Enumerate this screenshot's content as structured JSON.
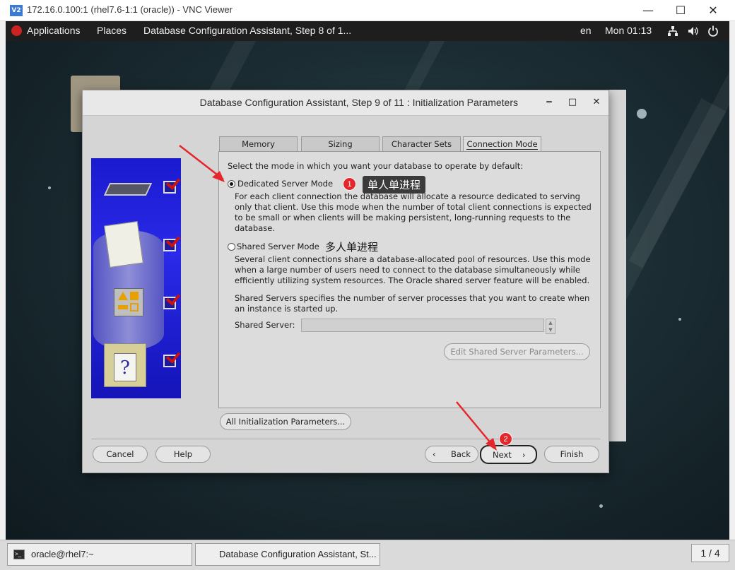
{
  "vnc": {
    "title": "172.16.0.100:1 (rhel7.6-1:1 (oracle)) - VNC Viewer",
    "logo": "V2",
    "minimize": "—",
    "maximize": "☐",
    "close": "✕"
  },
  "panel": {
    "applications": "Applications",
    "places": "Places",
    "window_title": "Database Configuration Assistant, Step 8 of 1...",
    "lang": "en",
    "clock": "Mon 01:13",
    "network_icon": "network-icon",
    "volume_icon": "volume-icon",
    "power_icon": "power-icon"
  },
  "dialog": {
    "title": "Database Configuration Assistant, Step 9 of 11 : Initialization Parameters",
    "min": "‒",
    "max": "□",
    "close": "✕",
    "tabs": [
      {
        "label": "Memory"
      },
      {
        "label": "Sizing"
      },
      {
        "label": "Character Sets"
      },
      {
        "label": "Connection Mode"
      }
    ],
    "active_tab": "Connection Mode",
    "intro": "Select the mode in which you want your database to operate by default:",
    "dedicated": {
      "label": "Dedicated Server Mode",
      "selected": true,
      "desc": [
        "For each client connection the database will allocate a resource dedicated to serving",
        "only that client.  Use this mode when the number of total client connections is expected",
        "to be small or when clients will be making persistent, long-running requests to the",
        "database."
      ]
    },
    "shared": {
      "label": "Shared Server Mode",
      "selected": false,
      "desc": [
        "Several client connections share a database-allocated pool of resources.  Use this mode",
        "when a large number of users need to connect to the database simultaneously while",
        "efficiently utilizing system resources.  The Oracle shared server feature will be enabled."
      ],
      "servers_desc": [
        "Shared Servers specifies the number of server processes that you want to create when",
        "an instance is started up."
      ],
      "server_label": "Shared Server:",
      "server_value": "",
      "edit_button": "Edit Shared Server Parameters..."
    },
    "all_params_button": "All Initialization Parameters...",
    "buttons": {
      "cancel": "Cancel",
      "help": "Help",
      "back": "Back",
      "next": "Next",
      "finish": "Finish"
    }
  },
  "annotations": {
    "badge1": "1",
    "badge2": "2",
    "callout1": "单人单进程",
    "callout2": "多人单进程",
    "arrow_color": "#e5262a"
  },
  "taskbar": {
    "terminal": "oracle@rhel7:~",
    "dbca": "Database Configuration Assistant, St...",
    "workspace": "1 / 4"
  }
}
